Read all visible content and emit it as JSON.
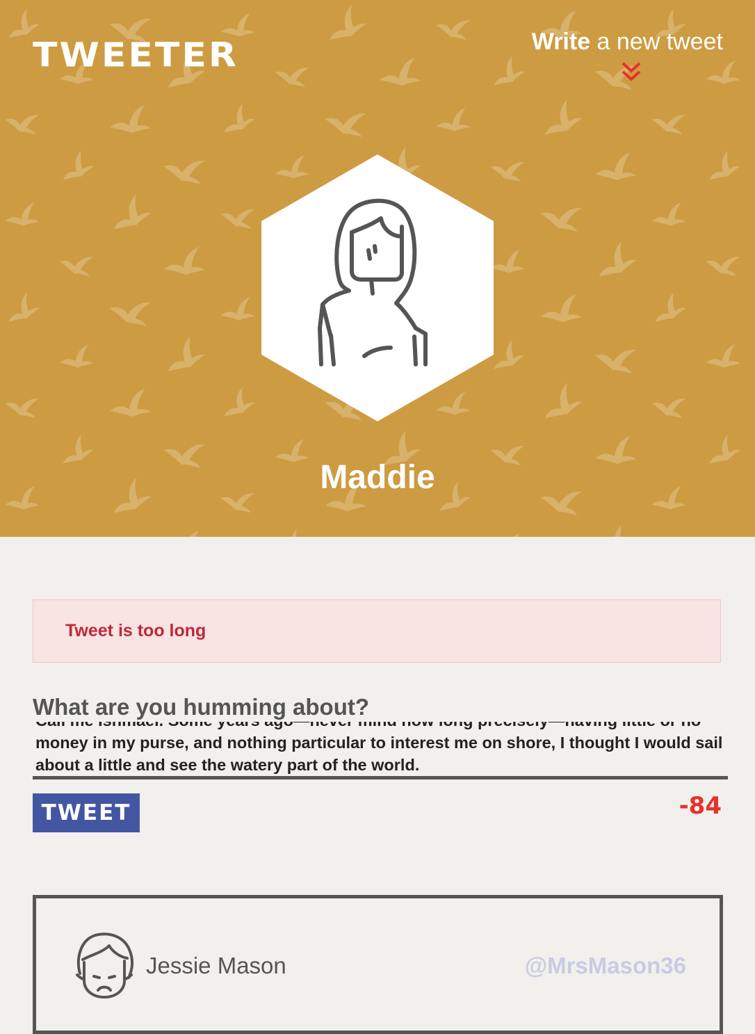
{
  "header": {
    "logo_text": "TWEETER",
    "compose_link_strong": "Write",
    "compose_link_rest": " a new tweet",
    "compose_icon": "double-chevron-down-icon"
  },
  "profile": {
    "name": "Maddie",
    "avatar_icon": "woman-avatar-icon"
  },
  "colors": {
    "hero_bg": "#cd9b41",
    "page_bg": "#f1f0ec",
    "accent_red": "#e6322a",
    "button_blue": "#4356a2",
    "error_bg": "#f9e4e4",
    "error_text": "#c0283a",
    "text_dark": "#555555",
    "handle_color": "#c8cbe2"
  },
  "error": {
    "message": "Tweet is too long"
  },
  "compose": {
    "label": "What are you humming about?",
    "value": "Call me Ishmael. Some years ago—never mind how long precisely—having little or no money in my purse, and nothing particular to interest me on shore, I thought I would sail about a little and see the watery part of the world.",
    "button_label": "TWEET",
    "counter": "-84"
  },
  "tweets": [
    {
      "name": "Jessie Mason",
      "handle": "@MrsMason36",
      "avatar_icon": "woman-avatar-icon"
    }
  ]
}
